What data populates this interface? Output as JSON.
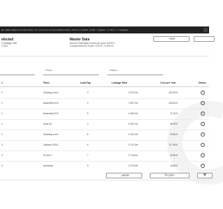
{
  "browser": {
    "url_host": "ec.sick.com",
    "url_path": "/en/production/rtv-process-setup/10dimension-ktkt3 1/pdata 1/10t 1 @dekt 2 ttkt 1 ?leakage"
  },
  "header": {
    "left_title": "elected",
    "left_lines": [
      "rl leakage rate",
      "2,000"
    ],
    "mid_title": "Master Data",
    "mid_lines": [
      "Annual Operating Hours per year: 8,000 h",
      "Compressed Air Costs: 0.20 € / 1,000 m³"
    ],
    "pdf_button": "PDF",
    "pdf_icon": "download-icon"
  },
  "filters": {
    "first": "",
    "place": "Place",
    "status": "Status"
  },
  "table": {
    "headers": {
      "id": "#",
      "place": "Place",
      "leak_tag": "Leak/Tag",
      "leakage_rate": "Leakage Rate",
      "cost_per_year": "Cost per Year",
      "status": "Status"
    },
    "rows": [
      {
        "id": "2",
        "place": "Cleaning room",
        "leak_tag": "3",
        "rate": "2.070 l/m",
        "cost": "200.90 €",
        "status_icon": "check-circle-icon"
      },
      {
        "id": "2",
        "place": "Assembly KCS",
        "leak_tag": "2",
        "rate": "1.997 l/m",
        "cost": "208.20 €",
        "status_icon": "check-circle-icon"
      },
      {
        "id": "1",
        "place": "Assembly KCS",
        "leak_tag": "5",
        "rate": "0.460 l/m",
        "cost": "71.40 €",
        "status_icon": "check-circle-icon"
      },
      {
        "id": "2",
        "place": "Hoist 16",
        "leak_tag": "4",
        "rate": "0.337 l/m",
        "cost": "90.90 €",
        "status_icon": "check-circle-icon"
      },
      {
        "id": "2",
        "place": "Cleaning room",
        "leak_tag": "8",
        "rate": "0.341 l/m",
        "cost": "29.60 €",
        "status_icon": "check-circle-icon"
      },
      {
        "id": "3",
        "place": "Cabinet HCEA",
        "leak_tag": "6",
        "rate": "0.747 l/m",
        "cost": "117.80 €",
        "status_icon": "arrow-circle-icon"
      },
      {
        "id": "3",
        "place": "IH-line 2",
        "leak_tag": "7",
        "rate": "0.746 l/m",
        "cost": "20.50 €",
        "status_icon": "arrow-circle-icon"
      },
      {
        "id": "3",
        "place": "workshop",
        "leak_tag": "9",
        "rate": "0.700 l/m",
        "cost": "40.80 €",
        "status_icon": "check-circle-icon"
      }
    ]
  },
  "footer": {
    "move_button": "MOVE",
    "copy_button": "COPY",
    "move_icon": "arrow-icon",
    "copy_icon": "copy-icon",
    "delete_icon": "trash-icon"
  }
}
